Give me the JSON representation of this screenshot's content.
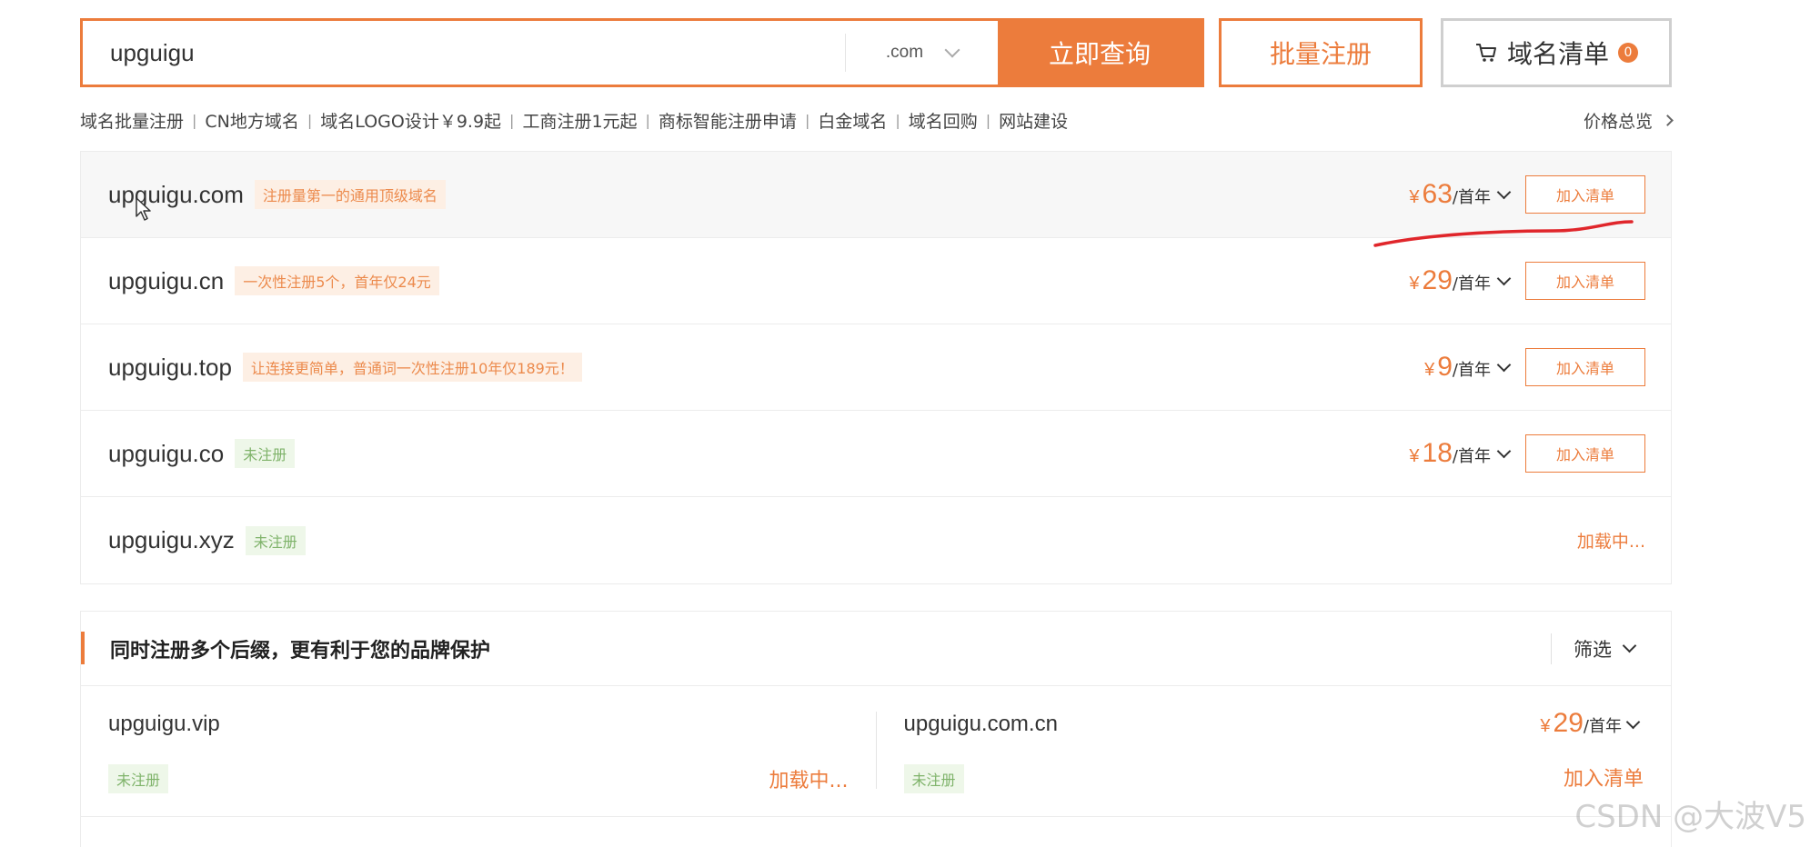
{
  "search": {
    "value": "upguigu",
    "tld": ".com",
    "submit_label": "立即查询",
    "batch_label": "批量注册",
    "cart_label": "域名清单",
    "cart_count": "0"
  },
  "subnav": {
    "links": [
      "域名批量注册",
      "CN地方域名",
      "域名LOGO设计￥9.9起",
      "工商注册1元起",
      "商标智能注册申请",
      "白金域名",
      "域名回购",
      "网站建设"
    ],
    "overview_label": "价格总览"
  },
  "results": [
    {
      "domain": "upguigu.com",
      "tag": "注册量第一的通用顶级域名",
      "tag_type": "promo",
      "currency": "¥",
      "price": "63",
      "unit": "/首年",
      "action": "加入清单"
    },
    {
      "domain": "upguigu.cn",
      "tag": "一次性注册5个，首年仅24元",
      "tag_type": "promo",
      "currency": "¥",
      "price": "29",
      "unit": "/首年",
      "action": "加入清单"
    },
    {
      "domain": "upguigu.top",
      "tag": "让连接更简单，普通词一次性注册10年仅189元！",
      "tag_type": "promo",
      "currency": "¥",
      "price": "9",
      "unit": "/首年",
      "action": "加入清单"
    },
    {
      "domain": "upguigu.co",
      "tag": "未注册",
      "tag_type": "status",
      "currency": "¥",
      "price": "18",
      "unit": "/首年",
      "action": "加入清单"
    },
    {
      "domain": "upguigu.xyz",
      "tag": "未注册",
      "tag_type": "status",
      "loading": "加载中..."
    }
  ],
  "multi_section": {
    "title": "同时注册多个后缀，更有利于您的品牌保护",
    "filter_label": "筛选",
    "items": [
      {
        "domain": "upguigu.vip",
        "tag": "未注册",
        "loading": "加载中..."
      },
      {
        "domain": "upguigu.com.cn",
        "tag": "未注册",
        "currency": "¥",
        "price": "29",
        "unit": "/首年",
        "action": "加入清单"
      }
    ]
  },
  "watermark": "CSDN @大波V5",
  "colors": {
    "accent": "#ec7c3c",
    "annotation": "#e0262b",
    "status_green": "#7fb36a"
  }
}
